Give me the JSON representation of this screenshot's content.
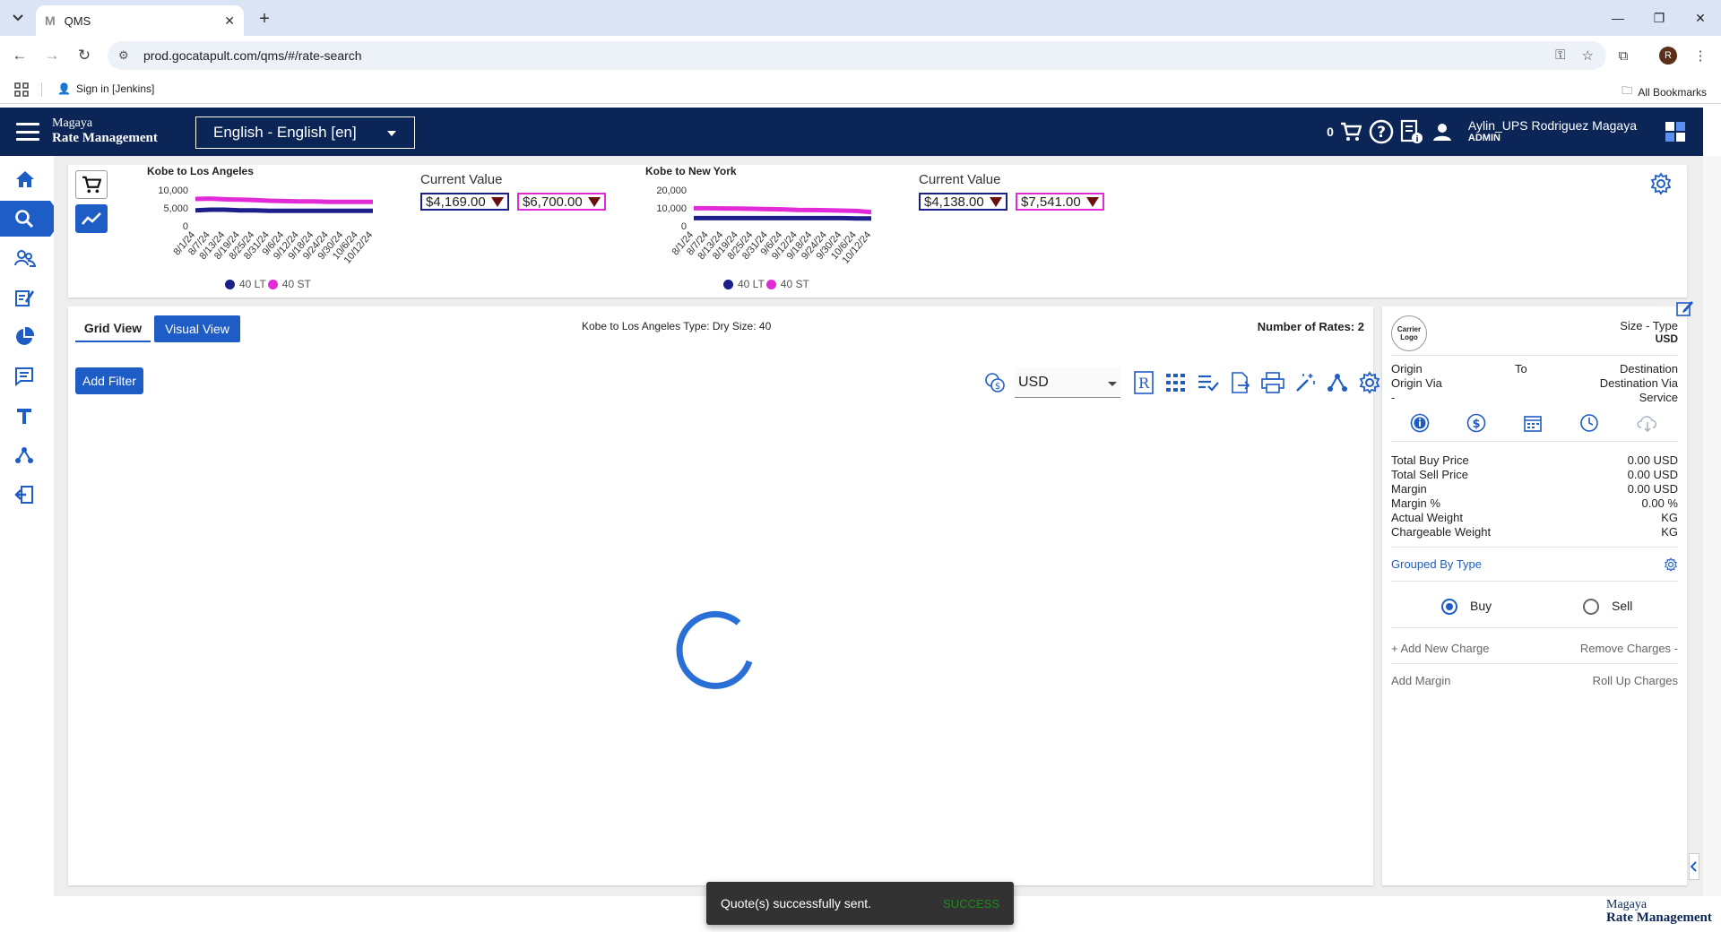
{
  "browser": {
    "tab_title": "QMS",
    "tab_favicon": "M",
    "url": "prod.gocatapult.com/qms/#/rate-search",
    "bookmark_item": "Sign in [Jenkins]",
    "all_bookmarks": "All Bookmarks",
    "profile_initial": "R"
  },
  "header": {
    "brand_line1": "Magaya",
    "brand_line2": "Rate Management",
    "language": "English - English [en]",
    "cart_count": "0",
    "user_name": "Aylin_UPS Rodriguez Magaya",
    "user_role": "ADMIN"
  },
  "chart_data": [
    {
      "type": "line",
      "title": "Kobe to Los Angeles",
      "categories": [
        "8/1/24",
        "8/7/24",
        "8/13/24",
        "8/19/24",
        "8/25/24",
        "8/31/24",
        "9/6/24",
        "9/12/24",
        "9/18/24",
        "9/24/24",
        "9/30/24",
        "10/6/24",
        "10/12/24"
      ],
      "y_ticks": [
        "10,000",
        "5,000",
        "0"
      ],
      "ylim": [
        0,
        10000
      ],
      "legend": "bottom",
      "series": [
        {
          "name": "40 LT",
          "color": "#1a1f8a",
          "values": [
            4300,
            4500,
            4500,
            4300,
            4300,
            4200,
            4200,
            4200,
            4200,
            4200,
            4200,
            4200,
            4200
          ]
        },
        {
          "name": "40 ST",
          "color": "#e22ad9",
          "values": [
            7500,
            7600,
            7400,
            7300,
            7200,
            7000,
            6900,
            6800,
            6800,
            6700,
            6700,
            6700,
            6700
          ]
        }
      ],
      "current_value_label": "Current Value",
      "current_values": [
        "$4,169.00",
        "$6,700.00"
      ]
    },
    {
      "type": "line",
      "title": "Kobe to New York",
      "categories": [
        "8/1/24",
        "8/7/24",
        "8/13/24",
        "8/19/24",
        "8/25/24",
        "8/31/24",
        "9/6/24",
        "9/12/24",
        "9/18/24",
        "9/24/24",
        "9/30/24",
        "10/6/24",
        "10/12/24"
      ],
      "y_ticks": [
        "20,000",
        "10,000",
        "0"
      ],
      "ylim": [
        0,
        20000
      ],
      "legend": "bottom",
      "series": [
        {
          "name": "40 LT",
          "color": "#1a1f8a",
          "values": [
            4300,
            4300,
            4300,
            4300,
            4300,
            4300,
            4300,
            4300,
            4300,
            4300,
            4300,
            4100,
            4100
          ]
        },
        {
          "name": "40 ST",
          "color": "#e22ad9",
          "values": [
            9800,
            9800,
            9700,
            9600,
            9500,
            9300,
            9200,
            8900,
            8800,
            8700,
            8500,
            8300,
            7600
          ]
        }
      ],
      "current_value_label": "Current Value",
      "current_values": [
        "$4,138.00",
        "$7,541.00"
      ]
    }
  ],
  "grid": {
    "tab_grid": "Grid View",
    "tab_visual": "Visual View",
    "route_info": "Kobe to Los Angeles Type: Dry Size: 40",
    "rate_count": "Number of Rates: 2",
    "add_filter": "Add Filter",
    "currency": "USD"
  },
  "panel": {
    "carrier_logo": "Carrier Logo",
    "size_type": "Size - Type",
    "currency": "USD",
    "origin": "Origin",
    "to": "To",
    "destination": "Destination",
    "origin_via": "Origin Via",
    "destination_via": "Destination Via",
    "dash": "-",
    "service": "Service",
    "totals": [
      {
        "label": "Total Buy Price",
        "value": "0.00 USD"
      },
      {
        "label": "Total Sell Price",
        "value": "0.00 USD"
      },
      {
        "label": "Margin",
        "value": "0.00 USD"
      },
      {
        "label": "Margin %",
        "value": "0.00 %"
      },
      {
        "label": "Actual Weight",
        "value": "KG"
      },
      {
        "label": "Chargeable Weight",
        "value": "KG"
      }
    ],
    "grouped_by": "Grouped By Type",
    "buy": "Buy",
    "sell": "Sell",
    "add_charge": "+ Add New Charge",
    "remove_charges": "Remove Charges -",
    "add_margin": "Add Margin",
    "roll_up": "Roll Up Charges"
  },
  "footer": {
    "brand_line1": "Magaya",
    "brand_line2": "Rate Management"
  },
  "toast": {
    "message": "Quote(s) successfully sent.",
    "action": "SUCCESS"
  }
}
